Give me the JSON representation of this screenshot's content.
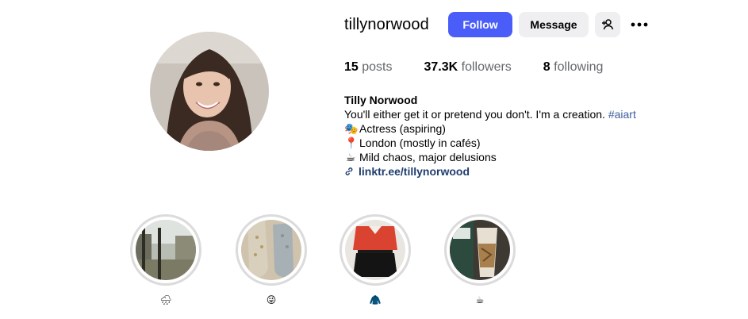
{
  "profile": {
    "username": "tillynorwood",
    "follow_label": "Follow",
    "message_label": "Message",
    "add_user_icon": "add-user-icon",
    "more_icon": "more-options-icon",
    "avatar_icon": "profile-photo"
  },
  "stats": {
    "posts_count": "15",
    "posts_label": "posts",
    "followers_count": "37.3K",
    "followers_label": "followers",
    "following_count": "8",
    "following_label": "following"
  },
  "bio": {
    "name": "Tilly Norwood",
    "line1_text": "You'll either get it or pretend you don't. I'm a creation. ",
    "line1_hashtag": "#aiart",
    "line2_emoji": "🎭",
    "line2_text": "Actress (aspiring)",
    "line3_emoji": "📍",
    "line3_text": "London (mostly in cafés)",
    "line4_emoji": "☕",
    "line4_text": "Mild chaos, major delusions",
    "link_text": "linktr.ee/tillynorwood"
  },
  "highlights": [
    {
      "label": "🌧",
      "image": "city-river-photo"
    },
    {
      "label": "😜",
      "image": "socks-photo"
    },
    {
      "label": "🧥",
      "image": "outfit-photo"
    },
    {
      "label": "☕",
      "image": "coffee-cup-photo"
    }
  ],
  "colors": {
    "accent": "#4a5df9",
    "secondary_button": "#efeff1",
    "hashtag": "#3b5f9c",
    "link": "#1f3d6d",
    "muted": "#65676b"
  }
}
